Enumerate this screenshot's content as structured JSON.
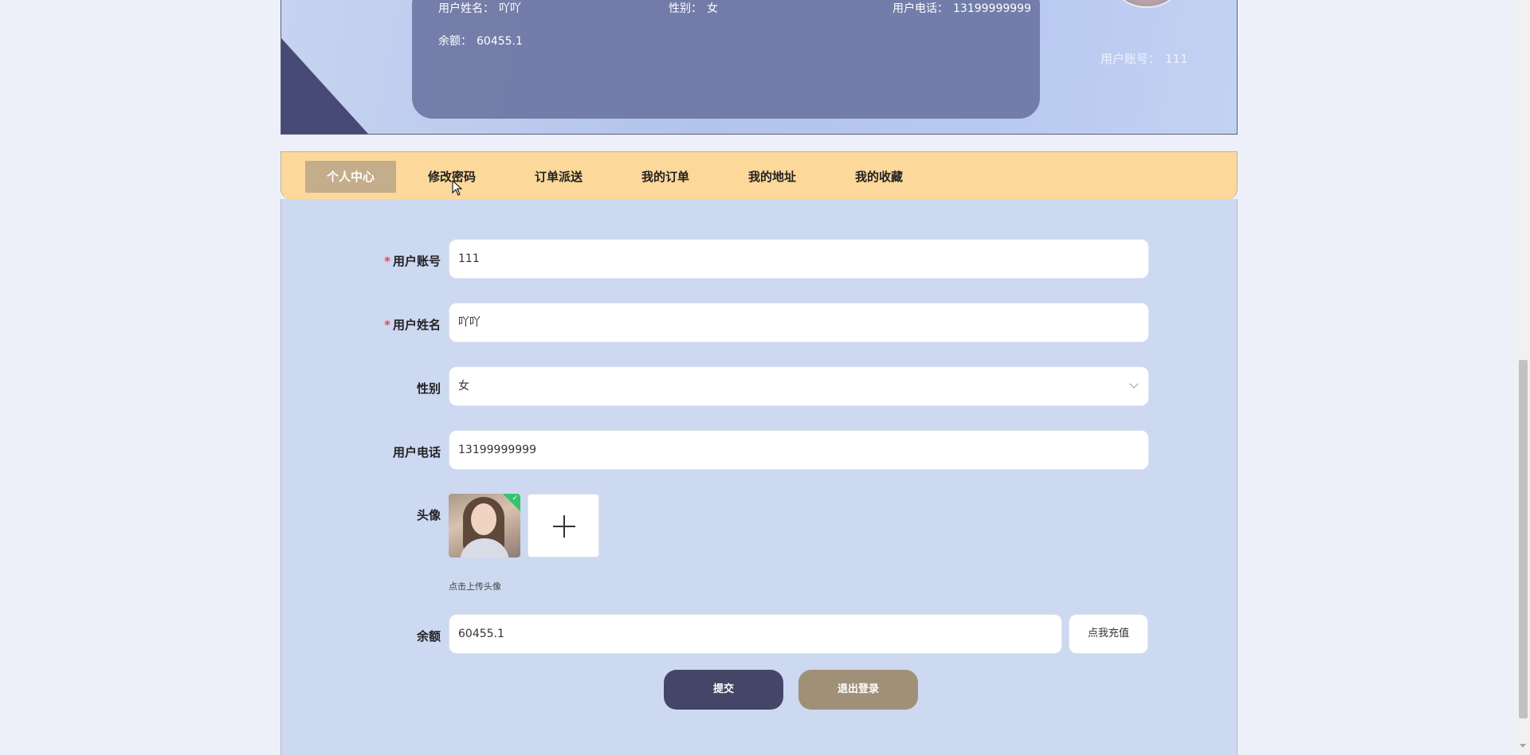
{
  "banner": {
    "name_label": "用户姓名：",
    "name_value": "吖吖",
    "gender_label": "性别：",
    "gender_value": "女",
    "phone_label": "用户电话：",
    "phone_value": "13199999999",
    "balance_label": "余额：",
    "balance_value": "60455.1",
    "account_label": "用户账号：",
    "account_value": "111"
  },
  "tabs": [
    {
      "label": "个人中心",
      "active": true
    },
    {
      "label": "修改密码"
    },
    {
      "label": "订单派送"
    },
    {
      "label": "我的订单"
    },
    {
      "label": "我的地址"
    },
    {
      "label": "我的收藏"
    }
  ],
  "form": {
    "account": {
      "label": "用户账号",
      "required_mark": "*",
      "value": "111"
    },
    "name": {
      "label": "用户姓名",
      "required_mark": "*",
      "value": "吖吖"
    },
    "gender": {
      "label": "性别",
      "value": "女"
    },
    "phone": {
      "label": "用户电话",
      "value": "13199999999"
    },
    "avatar": {
      "label": "头像",
      "hint": "点击上传头像"
    },
    "balance": {
      "label": "余额",
      "value": "60455.1",
      "recharge_label": "点我充值"
    }
  },
  "buttons": {
    "submit": "提交",
    "logout": "退出登录"
  },
  "colors": {
    "tab_bar": "#fdd89b",
    "active_tab": "#c4ad8b",
    "panel": "#cdd8f1",
    "submit": "#454667",
    "logout": "#a09078",
    "required": "#e04b4b"
  }
}
